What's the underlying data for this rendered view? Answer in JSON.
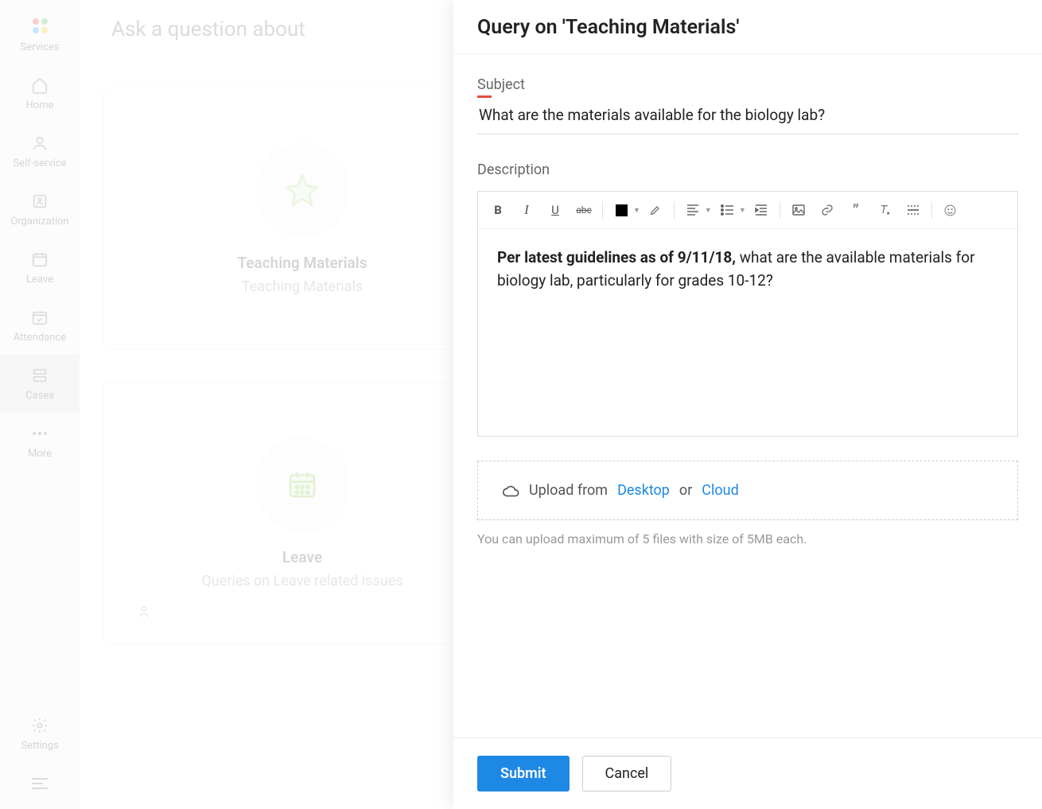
{
  "sidebar": {
    "items": [
      {
        "label": "Services"
      },
      {
        "label": "Home"
      },
      {
        "label": "Self-service"
      },
      {
        "label": "Organization"
      },
      {
        "label": "Leave"
      },
      {
        "label": "Attendance"
      },
      {
        "label": "Cases"
      },
      {
        "label": "More"
      }
    ],
    "settings_label": "Settings"
  },
  "main": {
    "ask_header": "Ask a question about",
    "cards": [
      {
        "title": "Teaching Materials",
        "subtitle": "Teaching Materials"
      },
      {
        "title": "Leave",
        "subtitle": "Queries on Leave related issues"
      }
    ]
  },
  "panel": {
    "title": "Query on 'Teaching Materials'",
    "subject_label": "Subject",
    "subject_value": "What are the materials available for the biology lab?",
    "description_label": "Description",
    "description_bold": "Per latest guidelines as of 9/11/18,",
    "description_rest": " what are the available materials for biology lab, particularly for grades 10-12?",
    "toolbar": {
      "bold": "B",
      "italic": "I",
      "underline": "U",
      "strike": "abc"
    },
    "upload": {
      "prefix": "Upload from",
      "desktop": "Desktop",
      "or": "or",
      "cloud": "Cloud",
      "note": "You can upload maximum of 5 files with size of 5MB each."
    },
    "buttons": {
      "submit": "Submit",
      "cancel": "Cancel"
    }
  }
}
